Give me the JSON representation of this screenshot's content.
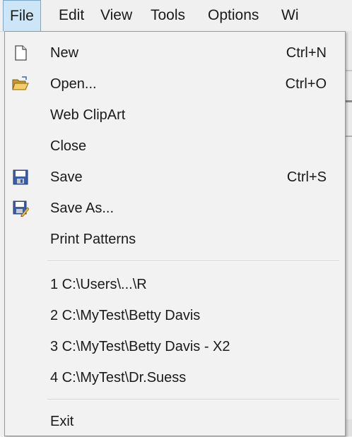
{
  "menubar": {
    "items": [
      {
        "label": "File"
      },
      {
        "label": "Edit"
      },
      {
        "label": "View"
      },
      {
        "label": "Tools"
      },
      {
        "label": "Options"
      },
      {
        "label": "Wi"
      }
    ]
  },
  "file_menu": {
    "items": [
      {
        "label": "New",
        "shortcut": "Ctrl+N",
        "icon": "new-document-icon"
      },
      {
        "label": "Open...",
        "shortcut": "Ctrl+O",
        "icon": "open-folder-icon"
      },
      {
        "label": "Web ClipArt",
        "shortcut": ""
      },
      {
        "label": "Close",
        "shortcut": ""
      },
      {
        "label": "Save",
        "shortcut": "Ctrl+S",
        "icon": "save-disk-icon"
      },
      {
        "label": "Save As...",
        "shortcut": "",
        "icon": "save-as-icon"
      },
      {
        "label": "Print Patterns",
        "shortcut": ""
      }
    ],
    "recent_files": [
      {
        "label": "1 C:\\Users\\...\\R"
      },
      {
        "label": "2 C:\\MyTest\\Betty Davis"
      },
      {
        "label": "3 C:\\MyTest\\Betty Davis - X2"
      },
      {
        "label": "4 C:\\MyTest\\Dr.Suess"
      }
    ],
    "exit": {
      "label": "Exit"
    }
  },
  "colors": {
    "menubar_active_bg": "#cde6f7",
    "menubar_active_border": "#7aa7c9",
    "menu_bg": "#f2f2f2",
    "menu_border": "#979797"
  }
}
